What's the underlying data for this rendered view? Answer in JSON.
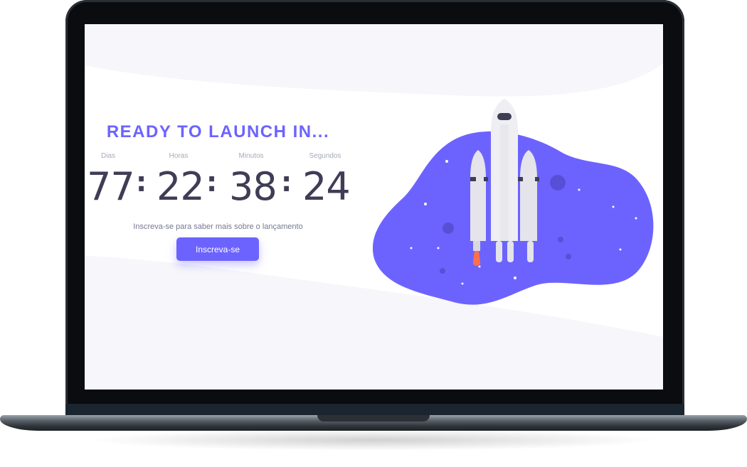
{
  "hero": {
    "headline": "READY TO LAUNCH IN...",
    "subtitle": "Inscreva-se para saber mais sobre o lançamento",
    "cta_label": "Inscreva-se"
  },
  "countdown": {
    "units": [
      {
        "label": "Dias",
        "value": "77"
      },
      {
        "label": "Horas",
        "value": "22"
      },
      {
        "label": "Minutos",
        "value": "38"
      },
      {
        "label": "Segundos",
        "value": "24"
      }
    ],
    "separator": ":"
  },
  "colors": {
    "accent": "#6c63ff",
    "text_dark": "#3f3d56",
    "muted": "#a7a9b8",
    "screen_bg": "#f6f6fb"
  },
  "icons": {
    "illustration": "rocket-illustration-icon"
  }
}
